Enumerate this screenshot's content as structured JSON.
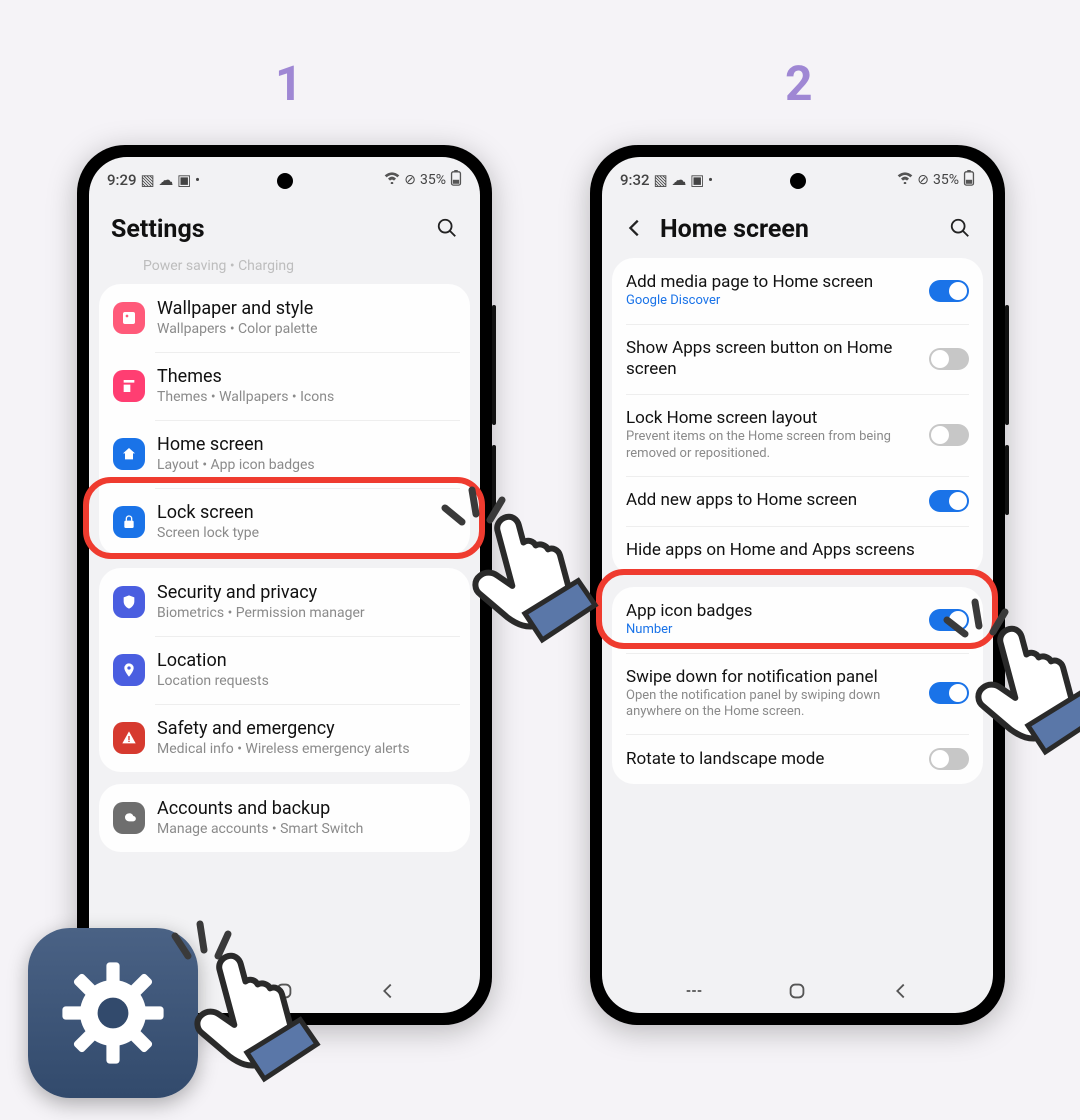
{
  "steps": {
    "one": "1",
    "two": "2"
  },
  "status": {
    "time1": "9:29",
    "time2": "9:32",
    "battery": "35%"
  },
  "screen1": {
    "title": "Settings",
    "peek": "Power saving  •  Charging",
    "items": {
      "wallpaper": {
        "title": "Wallpaper and style",
        "sub": "Wallpapers  •  Color palette"
      },
      "themes": {
        "title": "Themes",
        "sub": "Themes  •  Wallpapers  •  Icons"
      },
      "home": {
        "title": "Home screen",
        "sub": "Layout  •  App icon badges"
      },
      "lock": {
        "title": "Lock screen",
        "sub": "Screen lock type"
      },
      "security": {
        "title": "Security and privacy",
        "sub": "Biometrics  •  Permission manager"
      },
      "location": {
        "title": "Location",
        "sub": "Location requests"
      },
      "safety": {
        "title": "Safety and emergency",
        "sub": "Medical info  •  Wireless emergency alerts"
      },
      "accounts": {
        "title": "Accounts and backup",
        "sub": "Manage accounts  •  Smart Switch"
      }
    }
  },
  "screen2": {
    "title": "Home screen",
    "items": {
      "media": {
        "title": "Add media page to Home screen",
        "sub": "Google Discover",
        "on": true
      },
      "apps_btn": {
        "title": "Show Apps screen button on Home screen",
        "on": false
      },
      "lock": {
        "title": "Lock Home screen layout",
        "sub": "Prevent items on the Home screen from being removed or repositioned.",
        "on": false
      },
      "add_new": {
        "title": "Add new apps to Home screen",
        "on": true
      },
      "hide": {
        "title": "Hide apps on Home and Apps screens"
      },
      "badges": {
        "title": "App icon badges",
        "sub": "Number",
        "on": true
      },
      "swipe": {
        "title": "Swipe down for notification panel",
        "sub": "Open the notification panel by swiping down anywhere on the Home screen.",
        "on": true
      },
      "rotate": {
        "title": "Rotate to landscape mode",
        "on": false
      }
    }
  }
}
